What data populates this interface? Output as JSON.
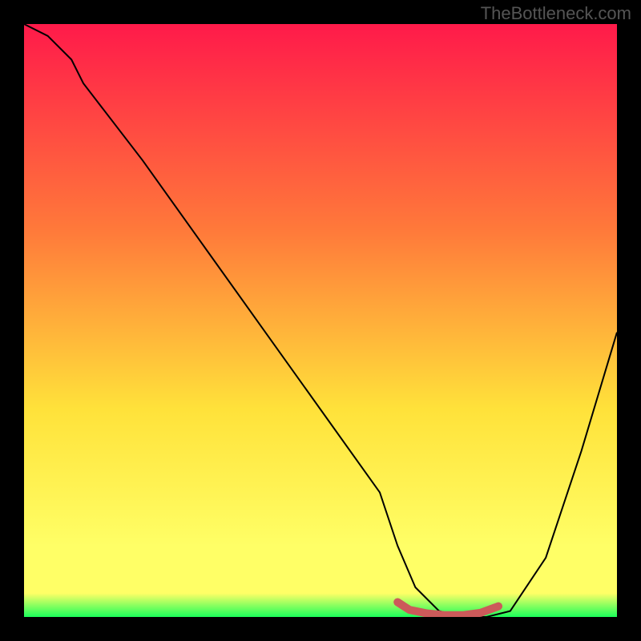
{
  "attribution": "TheBottleneck.com",
  "colors": {
    "gradient_top": "#ff1a4a",
    "gradient_mid1": "#ff7a3a",
    "gradient_mid2": "#ffe23a",
    "gradient_low": "#ffff66",
    "gradient_bottom": "#1aff5a",
    "curve": "#000000",
    "marker": "#cc5a5a",
    "background": "#000000"
  },
  "chart_data": {
    "type": "line",
    "title": "",
    "xlabel": "",
    "ylabel": "",
    "x_range": [
      0,
      100
    ],
    "y_range": [
      0,
      100
    ],
    "series": [
      {
        "name": "bottleneck-curve",
        "x": [
          0,
          4,
          8,
          10,
          20,
          30,
          40,
          50,
          60,
          63,
          66,
          70,
          74,
          78,
          82,
          88,
          94,
          100
        ],
        "y": [
          100,
          98,
          94,
          90,
          77,
          63,
          49,
          35,
          21,
          12,
          5,
          1,
          0,
          0,
          1,
          10,
          28,
          48
        ]
      }
    ],
    "markers": {
      "name": "optimal-range",
      "x": [
        63,
        65,
        68,
        71,
        74,
        77,
        80
      ],
      "y": [
        2.5,
        1.2,
        0.6,
        0.3,
        0.3,
        0.7,
        1.8
      ]
    }
  }
}
